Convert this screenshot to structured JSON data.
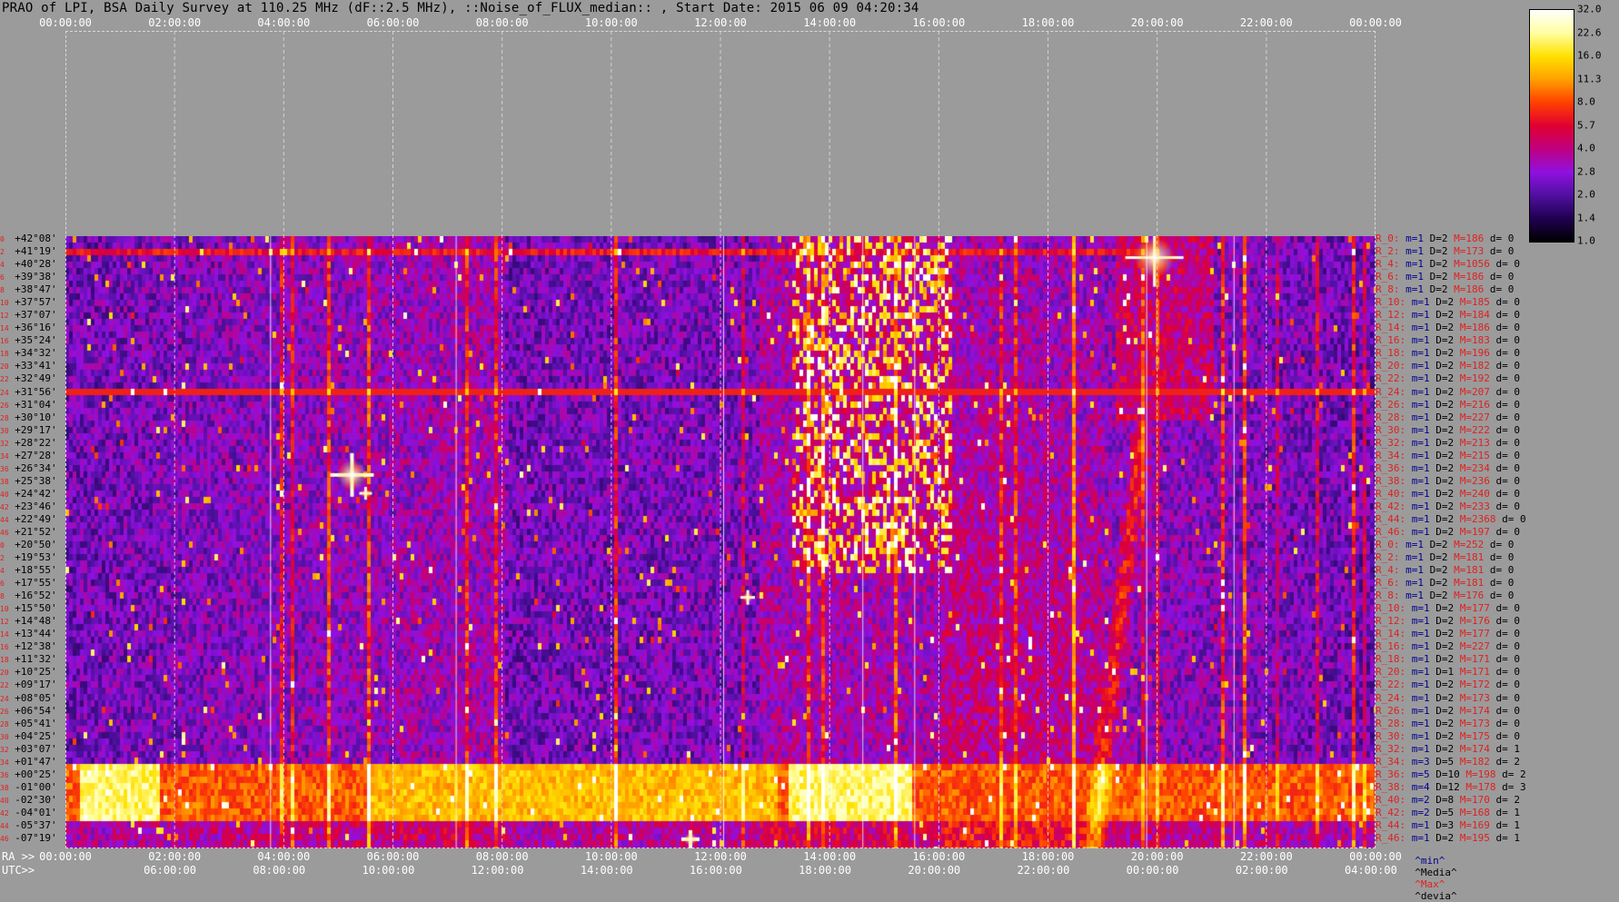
{
  "title": "PRAO of LPI, BSA Daily Survey at 110.25 MHz (dF::2.5 MHz), ::Noise_of_FLUX_median:: , Start Date: 2015 06 09 04:20:34",
  "top_axis_labels": [
    "00:00:00",
    "02:00:00",
    "04:00:00",
    "06:00:00",
    "08:00:00",
    "10:00:00",
    "12:00:00",
    "14:00:00",
    "16:00:00",
    "18:00:00",
    "20:00:00",
    "22:00:00",
    "00:00:00"
  ],
  "ra_prefix": "RA >>",
  "utc_prefix": "UTC>>",
  "ra_axis_labels": [
    "00:00:00",
    "02:00:00",
    "04:00:00",
    "06:00:00",
    "08:00:00",
    "10:00:00",
    "12:00:00",
    "14:00:00",
    "16:00:00",
    "18:00:00",
    "20:00:00",
    "22:00:00",
    "00:00:00"
  ],
  "utc_axis_labels": [
    "06:00:00",
    "08:00:00",
    "10:00:00",
    "12:00:00",
    "14:00:00",
    "16:00:00",
    "18:00:00",
    "20:00:00",
    "22:00:00",
    "00:00:00",
    "02:00:00",
    "04:00:00"
  ],
  "colorbar": {
    "ticks": [
      "32.0",
      "22.6",
      "16.0",
      "11.3",
      "8.0",
      "5.7",
      "4.0",
      "2.8",
      "2.0",
      "1.4",
      "1.0"
    ],
    "colors": [
      "#ffffff",
      "#ffffa0",
      "#ffe000",
      "#ffa000",
      "#ff4000",
      "#e00030",
      "#c00080",
      "#9010e0",
      "#5010a0",
      "#200050",
      "#000000"
    ]
  },
  "declinations": [
    "+42°08'",
    "+41°19'",
    "+40°28'",
    "+39°38'",
    "+38°47'",
    "+37°57'",
    "+37°07'",
    "+36°16'",
    "+35°24'",
    "+34°32'",
    "+33°41'",
    "+32°49'",
    "+31°56'",
    "+31°04'",
    "+30°10'",
    "+29°17'",
    "+28°22'",
    "+27°28'",
    "+26°34'",
    "+25°38'",
    "+24°42'",
    "+23°46'",
    "+22°49'",
    "+21°52'",
    "+20°50'",
    "+19°53'",
    "+18°55'",
    "+17°55'",
    "+16°52'",
    "+15°50'",
    "+14°48'",
    "+13°44'",
    "+12°38'",
    "+11°32'",
    "+10°25'",
    "+09°17'",
    "+08°05'",
    "+06°54'",
    "+05°41'",
    "+04°25'",
    "+03°07'",
    "+01°47'",
    "+00°25'",
    "-01°00'",
    "-02°30'",
    "-04°01'",
    "-05°37'",
    "-07°19'"
  ],
  "dec_index_labels": [
    "0",
    "2",
    "4",
    "6",
    "8",
    "10",
    "12",
    "14",
    "16",
    "18",
    "20",
    "22",
    "24",
    "26",
    "28",
    "30",
    "32",
    "34",
    "36",
    "38",
    "40",
    "42",
    "44",
    "46",
    "0",
    "2",
    "4",
    "6",
    "8",
    "10",
    "12",
    "14",
    "16",
    "18",
    "20",
    "22",
    "24",
    "26",
    "28",
    "30",
    "32",
    "34",
    "36",
    "38",
    "40",
    "42",
    "44",
    "46"
  ],
  "stats": [
    {
      "r": "R_0:",
      "m": "m=1",
      "d": "D=2",
      "M": "M=186",
      "dev": "d= 0"
    },
    {
      "r": "R_2:",
      "m": "m=1",
      "d": "D=2",
      "M": "M=173",
      "dev": "d= 0"
    },
    {
      "r": "R_4:",
      "m": "m=1",
      "d": "D=2",
      "M": "M=1056",
      "dev": "d= 0"
    },
    {
      "r": "R_6:",
      "m": "m=1",
      "d": "D=2",
      "M": "M=186",
      "dev": "d= 0"
    },
    {
      "r": "R_8:",
      "m": "m=1",
      "d": "D=2",
      "M": "M=186",
      "dev": "d= 0"
    },
    {
      "r": "R_10:",
      "m": "m=1",
      "d": "D=2",
      "M": "M=185",
      "dev": "d= 0"
    },
    {
      "r": "R_12:",
      "m": "m=1",
      "d": "D=2",
      "M": "M=184",
      "dev": "d= 0"
    },
    {
      "r": "R_14:",
      "m": "m=1",
      "d": "D=2",
      "M": "M=186",
      "dev": "d= 0"
    },
    {
      "r": "R_16:",
      "m": "m=1",
      "d": "D=2",
      "M": "M=183",
      "dev": "d= 0"
    },
    {
      "r": "R_18:",
      "m": "m=1",
      "d": "D=2",
      "M": "M=196",
      "dev": "d= 0"
    },
    {
      "r": "R_20:",
      "m": "m=1",
      "d": "D=2",
      "M": "M=182",
      "dev": "d= 0"
    },
    {
      "r": "R_22:",
      "m": "m=1",
      "d": "D=2",
      "M": "M=192",
      "dev": "d= 0"
    },
    {
      "r": "R_24:",
      "m": "m=1",
      "d": "D=2",
      "M": "M=207",
      "dev": "d= 0"
    },
    {
      "r": "R_26:",
      "m": "m=1",
      "d": "D=2",
      "M": "M=216",
      "dev": "d= 0"
    },
    {
      "r": "R_28:",
      "m": "m=1",
      "d": "D=2",
      "M": "M=227",
      "dev": "d= 0"
    },
    {
      "r": "R_30:",
      "m": "m=1",
      "d": "D=2",
      "M": "M=222",
      "dev": "d= 0"
    },
    {
      "r": "R_32:",
      "m": "m=1",
      "d": "D=2",
      "M": "M=213",
      "dev": "d= 0"
    },
    {
      "r": "R_34:",
      "m": "m=1",
      "d": "D=2",
      "M": "M=215",
      "dev": "d= 0"
    },
    {
      "r": "R_36:",
      "m": "m=1",
      "d": "D=2",
      "M": "M=234",
      "dev": "d= 0"
    },
    {
      "r": "R_38:",
      "m": "m=1",
      "d": "D=2",
      "M": "M=236",
      "dev": "d= 0"
    },
    {
      "r": "R_40:",
      "m": "m=1",
      "d": "D=2",
      "M": "M=240",
      "dev": "d= 0"
    },
    {
      "r": "R_42:",
      "m": "m=1",
      "d": "D=2",
      "M": "M=233",
      "dev": "d= 0"
    },
    {
      "r": "R_44:",
      "m": "m=1",
      "d": "D=2",
      "M": "M=2368",
      "dev": "d= 0"
    },
    {
      "r": "R_46:",
      "m": "m=1",
      "d": "D=2",
      "M": "M=197",
      "dev": "d= 0"
    },
    {
      "r": "R_0:",
      "m": "m=1",
      "d": "D=2",
      "M": "M=252",
      "dev": "d= 0"
    },
    {
      "r": "R_2:",
      "m": "m=1",
      "d": "D=2",
      "M": "M=181",
      "dev": "d= 0"
    },
    {
      "r": "R_4:",
      "m": "m=1",
      "d": "D=2",
      "M": "M=181",
      "dev": "d= 0"
    },
    {
      "r": "R_6:",
      "m": "m=1",
      "d": "D=2",
      "M": "M=181",
      "dev": "d= 0"
    },
    {
      "r": "R_8:",
      "m": "m=1",
      "d": "D=2",
      "M": "M=176",
      "dev": "d= 0"
    },
    {
      "r": "R_10:",
      "m": "m=1",
      "d": "D=2",
      "M": "M=177",
      "dev": "d= 0"
    },
    {
      "r": "R_12:",
      "m": "m=1",
      "d": "D=2",
      "M": "M=176",
      "dev": "d= 0"
    },
    {
      "r": "R_14:",
      "m": "m=1",
      "d": "D=2",
      "M": "M=177",
      "dev": "d= 0"
    },
    {
      "r": "R_16:",
      "m": "m=1",
      "d": "D=2",
      "M": "M=227",
      "dev": "d= 0"
    },
    {
      "r": "R_18:",
      "m": "m=1",
      "d": "D=2",
      "M": "M=171",
      "dev": "d= 0"
    },
    {
      "r": "R_20:",
      "m": "m=1",
      "d": "D=1",
      "M": "M=171",
      "dev": "d= 0"
    },
    {
      "r": "R_22:",
      "m": "m=1",
      "d": "D=2",
      "M": "M=172",
      "dev": "d= 0"
    },
    {
      "r": "R_24:",
      "m": "m=1",
      "d": "D=2",
      "M": "M=173",
      "dev": "d= 0"
    },
    {
      "r": "R_26:",
      "m": "m=1",
      "d": "D=2",
      "M": "M=174",
      "dev": "d= 0"
    },
    {
      "r": "R_28:",
      "m": "m=1",
      "d": "D=2",
      "M": "M=173",
      "dev": "d= 0"
    },
    {
      "r": "R_30:",
      "m": "m=1",
      "d": "D=2",
      "M": "M=175",
      "dev": "d= 0"
    },
    {
      "r": "R_32:",
      "m": "m=1",
      "d": "D=2",
      "M": "M=174",
      "dev": "d= 1"
    },
    {
      "r": "R_34:",
      "m": "m=3",
      "d": "D=5",
      "M": "M=182",
      "dev": "d= 2"
    },
    {
      "r": "R_36:",
      "m": "m=5",
      "d": "D=10",
      "M": "M=198",
      "dev": "d= 2"
    },
    {
      "r": "R_38:",
      "m": "m=4",
      "d": "D=12",
      "M": "M=178",
      "dev": "d= 3"
    },
    {
      "r": "R_40:",
      "m": "m=2",
      "d": "D=8",
      "M": "M=170",
      "dev": "d= 2"
    },
    {
      "r": "R_42:",
      "m": "m=2",
      "d": "D=5",
      "M": "M=168",
      "dev": "d= 1"
    },
    {
      "r": "R_44:",
      "m": "m=1",
      "d": "D=3",
      "M": "M=169",
      "dev": "d= 1"
    },
    {
      "r": "R_46:",
      "m": "m=1",
      "d": "D=2",
      "M": "M=195",
      "dev": "d= 1"
    }
  ],
  "stat_headers": {
    "min": "^min^",
    "median": "^Media^",
    "max": "^Max^",
    "dev": "^devia^"
  },
  "chart_data": {
    "type": "heatmap",
    "title": "PRAO of LPI, BSA Daily Survey at 110.25 MHz (dF::2.5 MHz), ::Noise_of_FLUX_median:: , Start Date: 2015 06 09 04:20:34",
    "x_ra_hours": [
      0,
      2,
      4,
      6,
      8,
      10,
      12,
      14,
      16,
      18,
      20,
      22,
      24
    ],
    "rows": 48,
    "value_range": [
      1.0,
      32.0
    ],
    "color_scale": "log",
    "features": [
      {
        "ra_hours_start": 0,
        "ra_hours_end": 24,
        "dec_range": [
          "+01°47'",
          "-04°01'"
        ],
        "level": 22.6
      },
      {
        "ra_hours_start": 13.3,
        "ra_hours_end": 16.2,
        "dec_range": [
          "+37°57'",
          "+16°52'"
        ],
        "level": 5.7
      },
      {
        "ra_hours": 19.9,
        "dec": "+41°19'",
        "level": 32.0
      },
      {
        "ra_hours": 5.2,
        "dec": "+23°46'",
        "level": 32.0
      },
      {
        "ra_hours": 12.5,
        "dec": "+12°38'",
        "level": 16.0
      },
      {
        "ra_hours": 11.5,
        "dec": "-07°19'",
        "level": 32.0
      },
      {
        "ra_hours_start": 18.8,
        "ra_hours_end": 20.5,
        "dec_range": [
          "+42°08'",
          "-07°19'"
        ],
        "level": 8.0
      }
    ]
  }
}
